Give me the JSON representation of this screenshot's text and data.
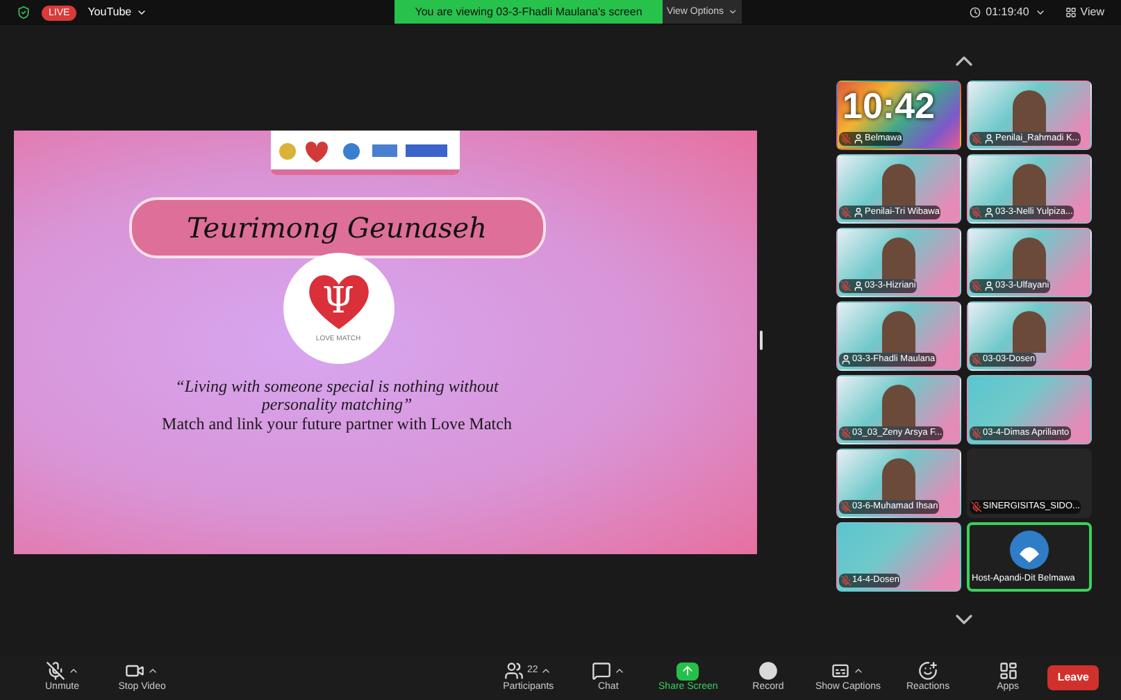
{
  "top_bar": {
    "live_badge": "LIVE",
    "stream_menu": "YouTube",
    "banner": "You are viewing 03-3-Fhadli Maulana's screen",
    "view_options": "View Options",
    "timer": "01:19:40",
    "view_button": "View"
  },
  "slide": {
    "title": "Teurimong Geunaseh",
    "logo_symbol": "Ψ",
    "logo_caption": "LOVE MATCH",
    "quote": "“Living with someone special is nothing without personality matching”",
    "tagline": "Match and link your future partner with Love Match"
  },
  "tiles": [
    {
      "kind": "clock",
      "clock": "10:42",
      "name": "Belmawa",
      "muted": true,
      "marked": true,
      "speaking": false
    },
    {
      "kind": "video",
      "name": "Penilai_Rahmadi K...",
      "muted": true,
      "marked": true,
      "speaking": false
    },
    {
      "kind": "video",
      "name": "Penilai-Tri Wibawa",
      "muted": true,
      "marked": true,
      "speaking": false
    },
    {
      "kind": "video",
      "name": "03-3-Nelli Yulpiza...",
      "muted": true,
      "marked": true,
      "speaking": false
    },
    {
      "kind": "video",
      "name": "03-3-Hizriani",
      "muted": true,
      "marked": true,
      "speaking": false
    },
    {
      "kind": "video",
      "name": "03-3-Ulfayani",
      "muted": true,
      "marked": true,
      "speaking": false
    },
    {
      "kind": "video",
      "name": "03-3-Fhadli Maulana",
      "muted": false,
      "marked": true,
      "speaking": false
    },
    {
      "kind": "video",
      "name": "03-03-Dosen",
      "muted": true,
      "marked": false,
      "speaking": false
    },
    {
      "kind": "video",
      "name": "03_03_Zeny Arsya F...",
      "muted": true,
      "marked": false,
      "speaking": false
    },
    {
      "kind": "backdrop",
      "name": "03-4-Dimas Aprilianto",
      "muted": true,
      "marked": false,
      "speaking": false
    },
    {
      "kind": "video",
      "name": "03-6-Muhamad Ihsan",
      "muted": true,
      "marked": false,
      "speaking": false
    },
    {
      "kind": "blank",
      "name": "SINERGISITAS_SIDO...",
      "muted": true,
      "marked": false,
      "speaking": false
    },
    {
      "kind": "backdrop",
      "name": "14-4-Dosen",
      "muted": true,
      "marked": false,
      "speaking": false
    },
    {
      "kind": "logo",
      "name": "Host-Apandi-Dit Belmawa",
      "muted": false,
      "marked": false,
      "speaking": true
    }
  ],
  "toolbar": [
    {
      "kind": "mic",
      "label": "Unmute",
      "caret": true
    },
    {
      "kind": "video",
      "label": "Stop Video",
      "caret": true
    },
    {
      "kind": "participants",
      "label": "Participants",
      "count": "22",
      "caret": true
    },
    {
      "kind": "chat",
      "label": "Chat",
      "caret": true
    },
    {
      "kind": "share",
      "label": "Share Screen",
      "caret": false
    },
    {
      "kind": "record",
      "label": "Record",
      "caret": false
    },
    {
      "kind": "captions",
      "label": "Show Captions",
      "caret": true
    },
    {
      "kind": "reactions",
      "label": "Reactions",
      "caret": false
    },
    {
      "kind": "apps",
      "label": "Apps",
      "caret": false
    }
  ],
  "leave_button": "Leave"
}
